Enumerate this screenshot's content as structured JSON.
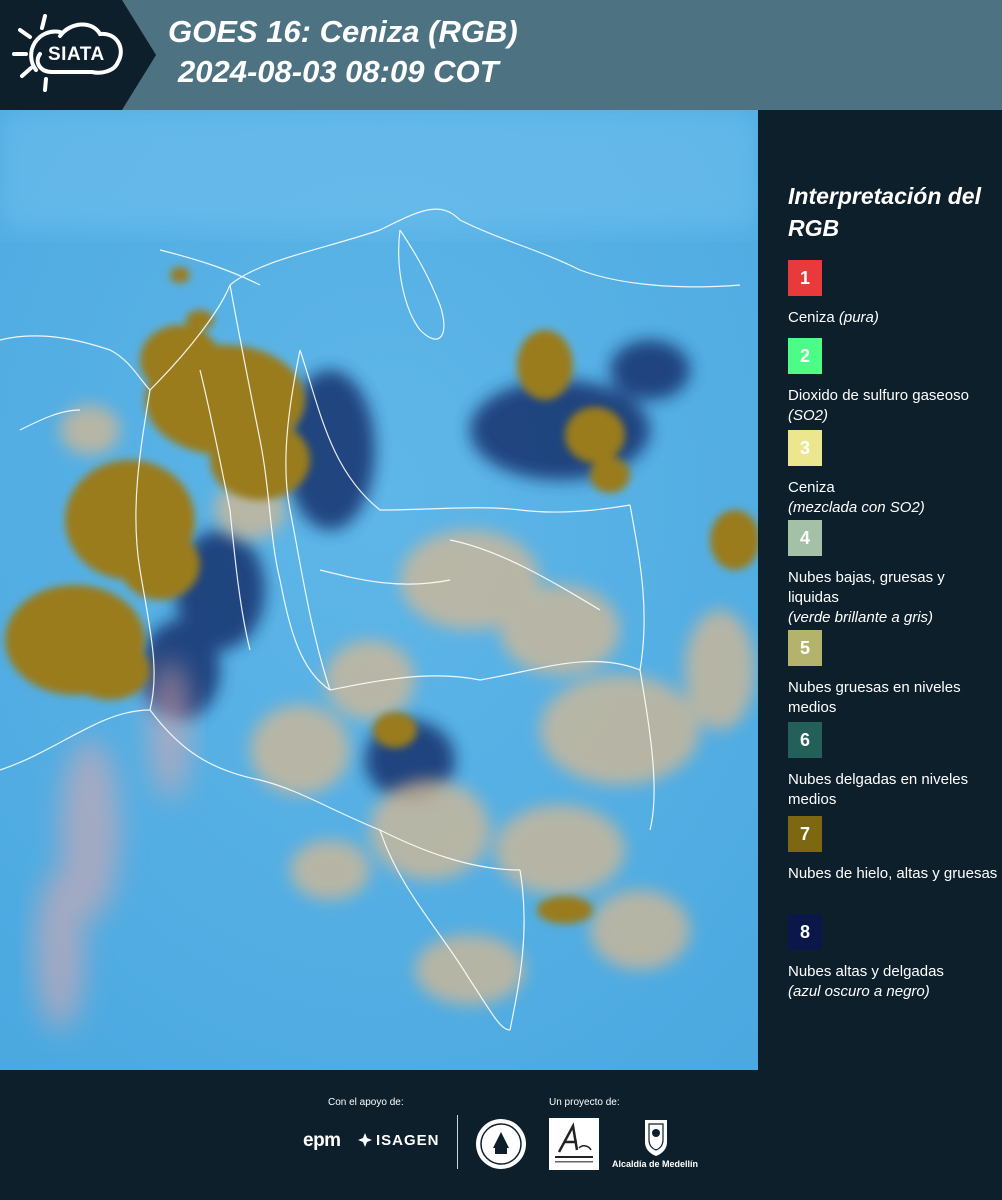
{
  "header": {
    "logo_text": "SIATA",
    "title": "GOES 16: Ceniza (RGB)",
    "timestamp": "2024-08-03 08:09 COT",
    "colors": {
      "header_bg": "#4d7281",
      "logo_bg": "#0c1f2b"
    }
  },
  "legend": {
    "title": "Interpretación del RGB",
    "items": [
      {
        "number": "1",
        "label": "Ceniza",
        "note": "(pura)",
        "color": "#e83a3a",
        "text_color": "#ffffff"
      },
      {
        "number": "2",
        "label": "Dioxido de sulfuro gaseoso",
        "note": "(SO2)",
        "color": "#4dfc87",
        "text_color": "#ffffff"
      },
      {
        "number": "3",
        "label": "Ceniza",
        "note": "(mezclada con SO2)",
        "color": "#ece78f",
        "text_color": "#ffffff"
      },
      {
        "number": "4",
        "label": "Nubes bajas, gruesas y liquidas",
        "note": "(verde brillante a gris)",
        "color": "#a4c0a6",
        "text_color": "#ffffff"
      },
      {
        "number": "5",
        "label": "Nubes gruesas en niveles medios",
        "note": "",
        "color": "#b4b36c",
        "text_color": "#ffffff"
      },
      {
        "number": "6",
        "label": "Nubes delgadas en niveles medios",
        "note": "",
        "color": "#23605a",
        "text_color": "#ffffff"
      },
      {
        "number": "7",
        "label": "Nubes de hielo, altas y gruesas",
        "note": "",
        "color": "#7d6710",
        "text_color": "#ffffff"
      },
      {
        "number": "8",
        "label": "Nubes altas y delgadas",
        "note": "(azul oscuro a negro)",
        "color": "#0b1748",
        "text_color": "#ffffff"
      }
    ]
  },
  "footer": {
    "support_label": "Con el apoyo de:",
    "project_label": "Un proyecto de:",
    "epm": "epm",
    "isagen": "ISAGEN",
    "alcaldia": "Alcaldía de Medellín"
  }
}
